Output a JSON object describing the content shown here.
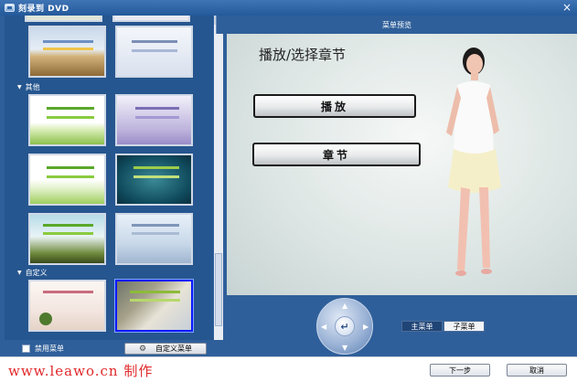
{
  "window": {
    "title": "刻录到 DVD",
    "close_glyph": "×"
  },
  "left_panel": {
    "section_other": "其他",
    "section_custom": "自定义",
    "disable_menu_label": "禁用菜单",
    "custom_menu_button": "自定义菜单"
  },
  "preview": {
    "header": "菜单预览",
    "title": "播放/选择章节",
    "play_button": "播放",
    "chapter_button": "章节"
  },
  "navigation": {
    "enter_glyph": "↵",
    "tabs": [
      {
        "label": "主菜单",
        "active": true
      },
      {
        "label": "子菜单",
        "active": false
      }
    ]
  },
  "footer": {
    "watermark": "www.leawo.cn 制作",
    "next_button": "下一步",
    "cancel_button": "取消"
  },
  "colors": {
    "panel_blue": "#2f5f9a",
    "selected_border": "#0a17ff",
    "watermark_red": "#e0282b"
  }
}
